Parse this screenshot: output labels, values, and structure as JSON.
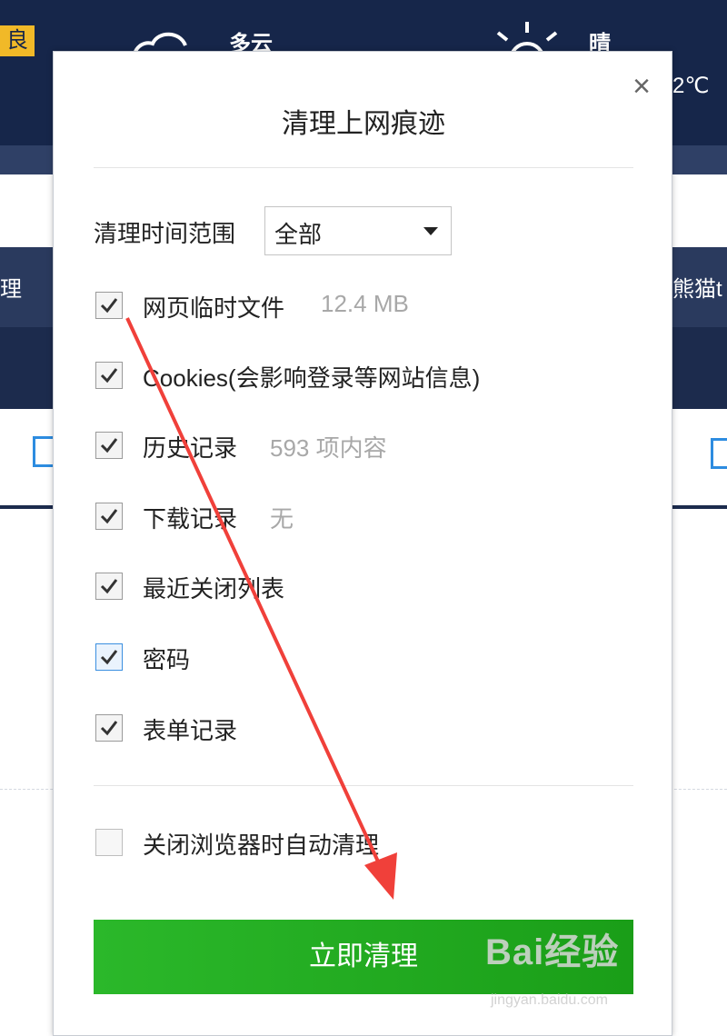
{
  "background": {
    "air_quality_badge": "良",
    "weather_left": "多云",
    "weather_right": "晴",
    "temperature_fragment": "2℃",
    "nav_left_fragment": "理",
    "nav_right_fragment": "熊猫t"
  },
  "dialog": {
    "title": "清理上网痕迹",
    "close_label": "×",
    "time_range": {
      "label": "清理时间范围",
      "selected": "全部"
    },
    "options": [
      {
        "label": "网页临时文件",
        "extra": "12.4 MB",
        "checked": true
      },
      {
        "label": "Cookies(会影响登录等网站信息)",
        "extra": "",
        "checked": true
      },
      {
        "label": "历史记录",
        "extra": "593 项内容",
        "checked": true
      },
      {
        "label": "下载记录",
        "extra": "无",
        "checked": true
      },
      {
        "label": "最近关闭列表",
        "extra": "",
        "checked": true
      },
      {
        "label": "密码",
        "extra": "",
        "checked": true
      },
      {
        "label": "表单记录",
        "extra": "",
        "checked": true
      }
    ],
    "auto_clean": {
      "label": "关闭浏览器时自动清理",
      "checked": false
    },
    "primary_button": "立即清理"
  },
  "watermark": {
    "brand": "Bai经验",
    "url": "jingyan.baidu.com"
  },
  "colors": {
    "header_bg": "#16264a",
    "button_green": "#22ac20",
    "annotation_arrow": "#f0403a",
    "checkbox_focus": "#3b8fe0"
  }
}
